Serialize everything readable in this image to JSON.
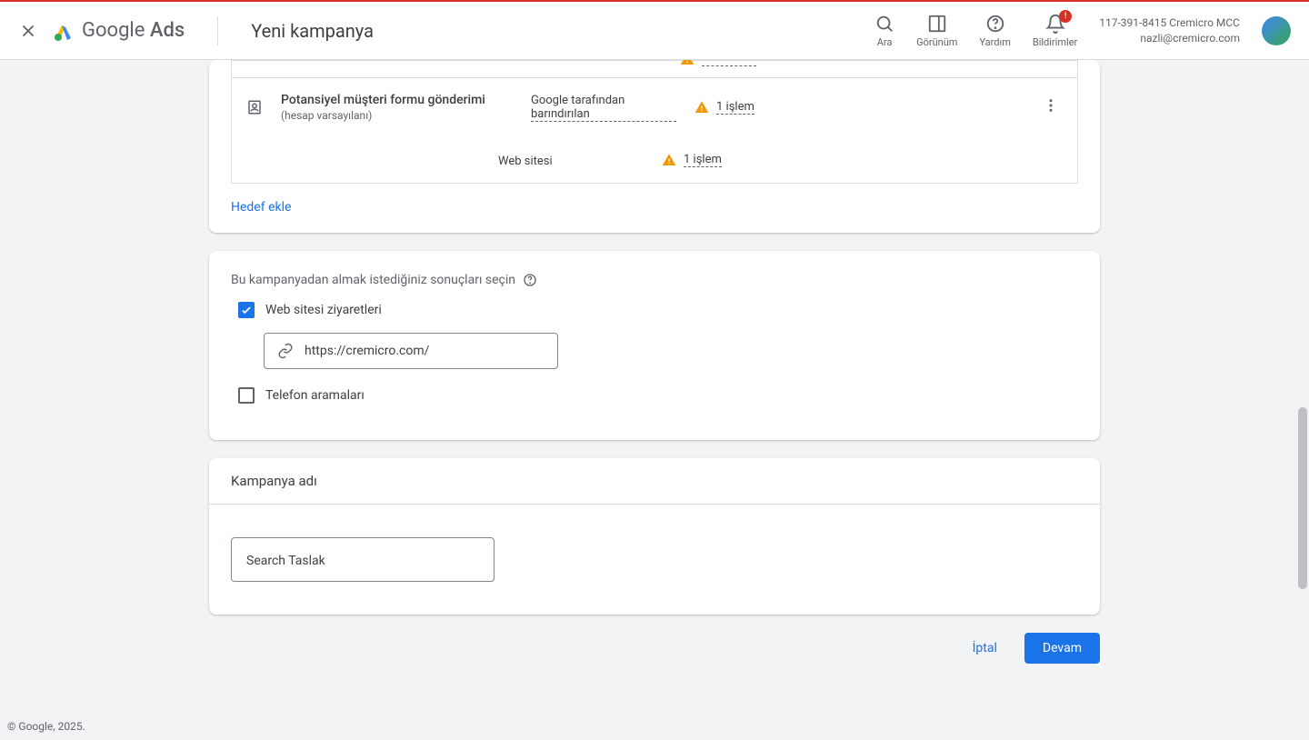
{
  "header": {
    "brand_google": "Google",
    "brand_ads": "Ads",
    "page_title": "Yeni kampanya",
    "search_label": "Ara",
    "view_label": "Görünüm",
    "help_label": "Yardım",
    "notifications_label": "Bildirimler",
    "notifications_badge": "!",
    "account_line1": "117-391-8415 Cremicro MCC",
    "account_line2": "nazli@cremicro.com"
  },
  "goals": {
    "partial_action": "- - - - - -",
    "row1": {
      "name": "Potansiyel müşteri formu gönderimi",
      "default": "(hesap varsayılanı)",
      "source1": "Google tarafından barındırılan",
      "action1": "1 işlem",
      "source2": "Web sitesi",
      "action2": "1 işlem"
    },
    "add_goal": "Hedef ekle"
  },
  "results": {
    "section_label": "Bu kampanyadan almak istediğiniz sonuçları seçin",
    "website_visits": "Web sitesi ziyaretleri",
    "url_value": "https://cremicro.com/",
    "phone_calls": "Telefon aramaları"
  },
  "campaign_name": {
    "title": "Kampanya adı",
    "value": "Search Taslak"
  },
  "buttons": {
    "cancel": "İptal",
    "continue": "Devam"
  },
  "footer": {
    "copyright": "© Google, 2025."
  }
}
